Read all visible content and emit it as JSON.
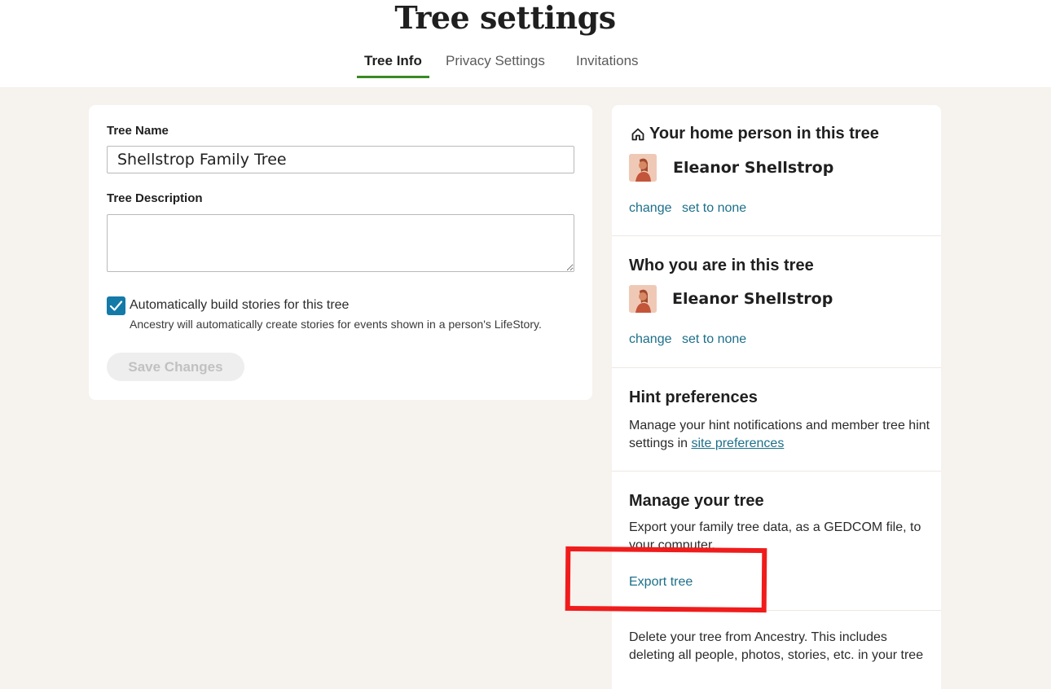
{
  "header": {
    "title": "Tree settings",
    "tabs": [
      {
        "label": "Tree Info",
        "active": true
      },
      {
        "label": "Privacy Settings",
        "active": false
      },
      {
        "label": "Invitations",
        "active": false
      }
    ],
    "accent_color": "#3a8a22"
  },
  "tree_info": {
    "name_label": "Tree Name",
    "name_value": "Shellstrop Family Tree",
    "description_label": "Tree Description",
    "description_value": "",
    "auto_stories": {
      "checked": true,
      "label": "Automatically build stories for this tree",
      "help": "Ancestry will automatically create stories for events shown in a person's LifeStory."
    },
    "save_label": "Save Changes",
    "save_disabled": true
  },
  "sidebar": {
    "home_person": {
      "title": "Your home person in this tree",
      "icon": "home-icon",
      "person_name": "Eleanor Shellstrop",
      "change_label": "change",
      "set_none_label": "set to none"
    },
    "who_you_are": {
      "title": "Who you are in this tree",
      "person_name": "Eleanor Shellstrop",
      "change_label": "change",
      "set_none_label": "set to none"
    },
    "hint_preferences": {
      "title": "Hint preferences",
      "text": "Manage your hint notifications and member tree hint settings in ",
      "link_label": "site preferences"
    },
    "manage_tree": {
      "title": "Manage your tree",
      "text": "Export your family tree data, as a GEDCOM file, to your computer.",
      "export_label": "Export tree"
    },
    "delete_tree": {
      "text": "Delete your tree from Ancestry. This includes deleting all people, photos, stories, etc. in your tree"
    },
    "link_color": "#1c6f8a"
  },
  "annotation": {
    "highlight_color": "#f01c1c"
  }
}
